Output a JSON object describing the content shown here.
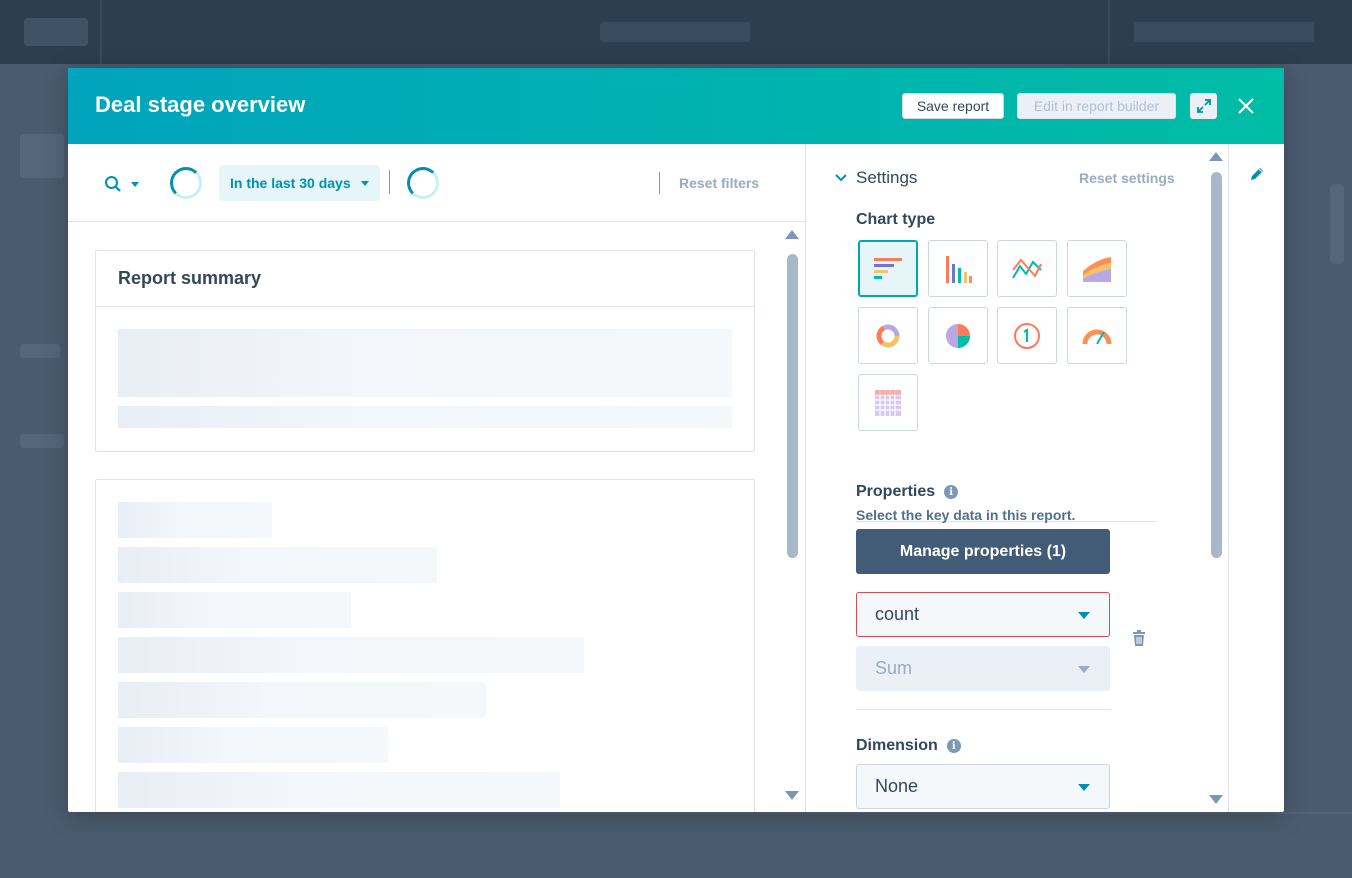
{
  "modal": {
    "title": "Deal stage overview",
    "save_report_label": "Save report",
    "edit_in_builder_label": "Edit in report builder"
  },
  "filters": {
    "date_range_label": "In the last 30 days",
    "reset_filters_label": "Reset filters"
  },
  "report_summary": {
    "title": "Report summary"
  },
  "settings": {
    "header_label": "Settings",
    "reset_settings_label": "Reset settings",
    "chart_type_label": "Chart type",
    "chart_types": [
      {
        "name": "horizontal-bar",
        "selected": true
      },
      {
        "name": "vertical-bar",
        "selected": false
      },
      {
        "name": "line",
        "selected": false
      },
      {
        "name": "area",
        "selected": false
      },
      {
        "name": "donut",
        "selected": false
      },
      {
        "name": "pie",
        "selected": false
      },
      {
        "name": "summary",
        "selected": false
      },
      {
        "name": "gauge",
        "selected": false
      },
      {
        "name": "table",
        "selected": false
      }
    ],
    "properties_label": "Properties",
    "properties_subtext": "Select the key data in this report.",
    "manage_properties_label": "Manage properties (1)",
    "property_value": "count",
    "aggregation_value": "Sum",
    "dimension_label": "Dimension",
    "dimension_value": "None"
  },
  "colors": {
    "header_gradient_start": "#00a4bd",
    "header_gradient_end": "#00bda5",
    "accent": "#0091ae",
    "primary_dark": "#425b76",
    "error_border": "#d94c53"
  },
  "icons": {
    "expand": "expand-icon",
    "close": "close-icon",
    "search": "search-icon",
    "pencil": "pencil-icon",
    "trash": "trash-icon",
    "info": "info-icon",
    "chevron": "chevron-down-icon"
  }
}
